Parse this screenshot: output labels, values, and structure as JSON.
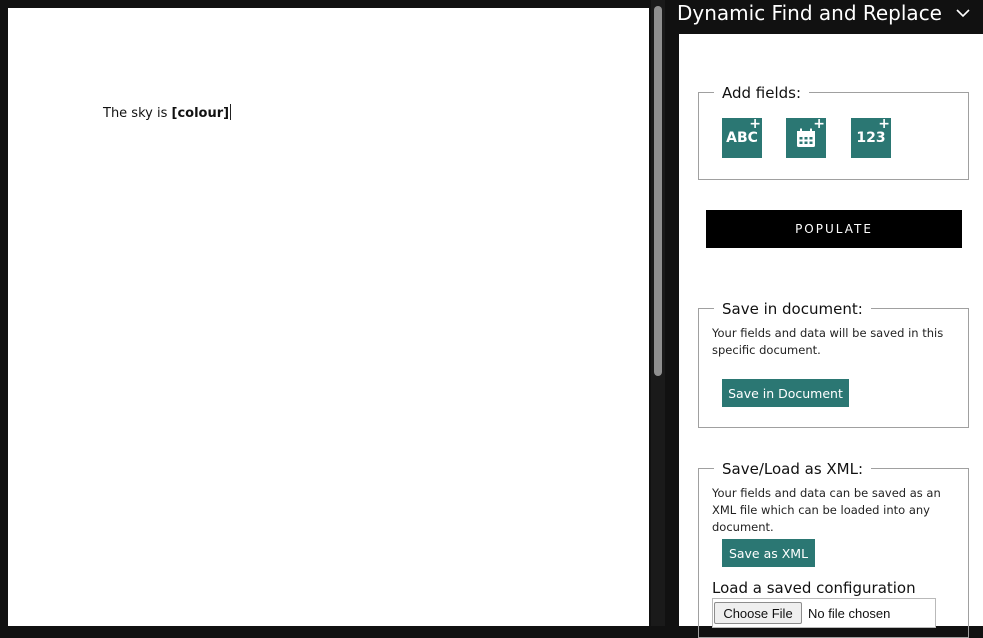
{
  "document": {
    "text_before": "The sky is ",
    "field_text": "[colour]"
  },
  "pane": {
    "title": "Dynamic Find and Replace",
    "chevron_icon": "chevron-down-icon"
  },
  "add_fields": {
    "legend": "Add fields:",
    "text_icon_label": "ABC",
    "date_icon": "calendar-plus-icon",
    "number_icon_label": "123",
    "plus": "+"
  },
  "populate": {
    "label": "POPULATE"
  },
  "save_document": {
    "legend": "Save in document:",
    "description": "Your fields and data will be saved in this specific document.",
    "button": "Save in Document"
  },
  "save_xml": {
    "legend": "Save/Load as XML:",
    "description": "Your fields and data can be saved as an XML file which can be loaded into any document.",
    "button": "Save as XML",
    "load_label": "Load a saved configuration",
    "choose_file": "Choose File",
    "no_file": "No file chosen"
  },
  "colors": {
    "accent": "#2b7773",
    "populate_bg": "#000000",
    "chrome": "#111111"
  }
}
